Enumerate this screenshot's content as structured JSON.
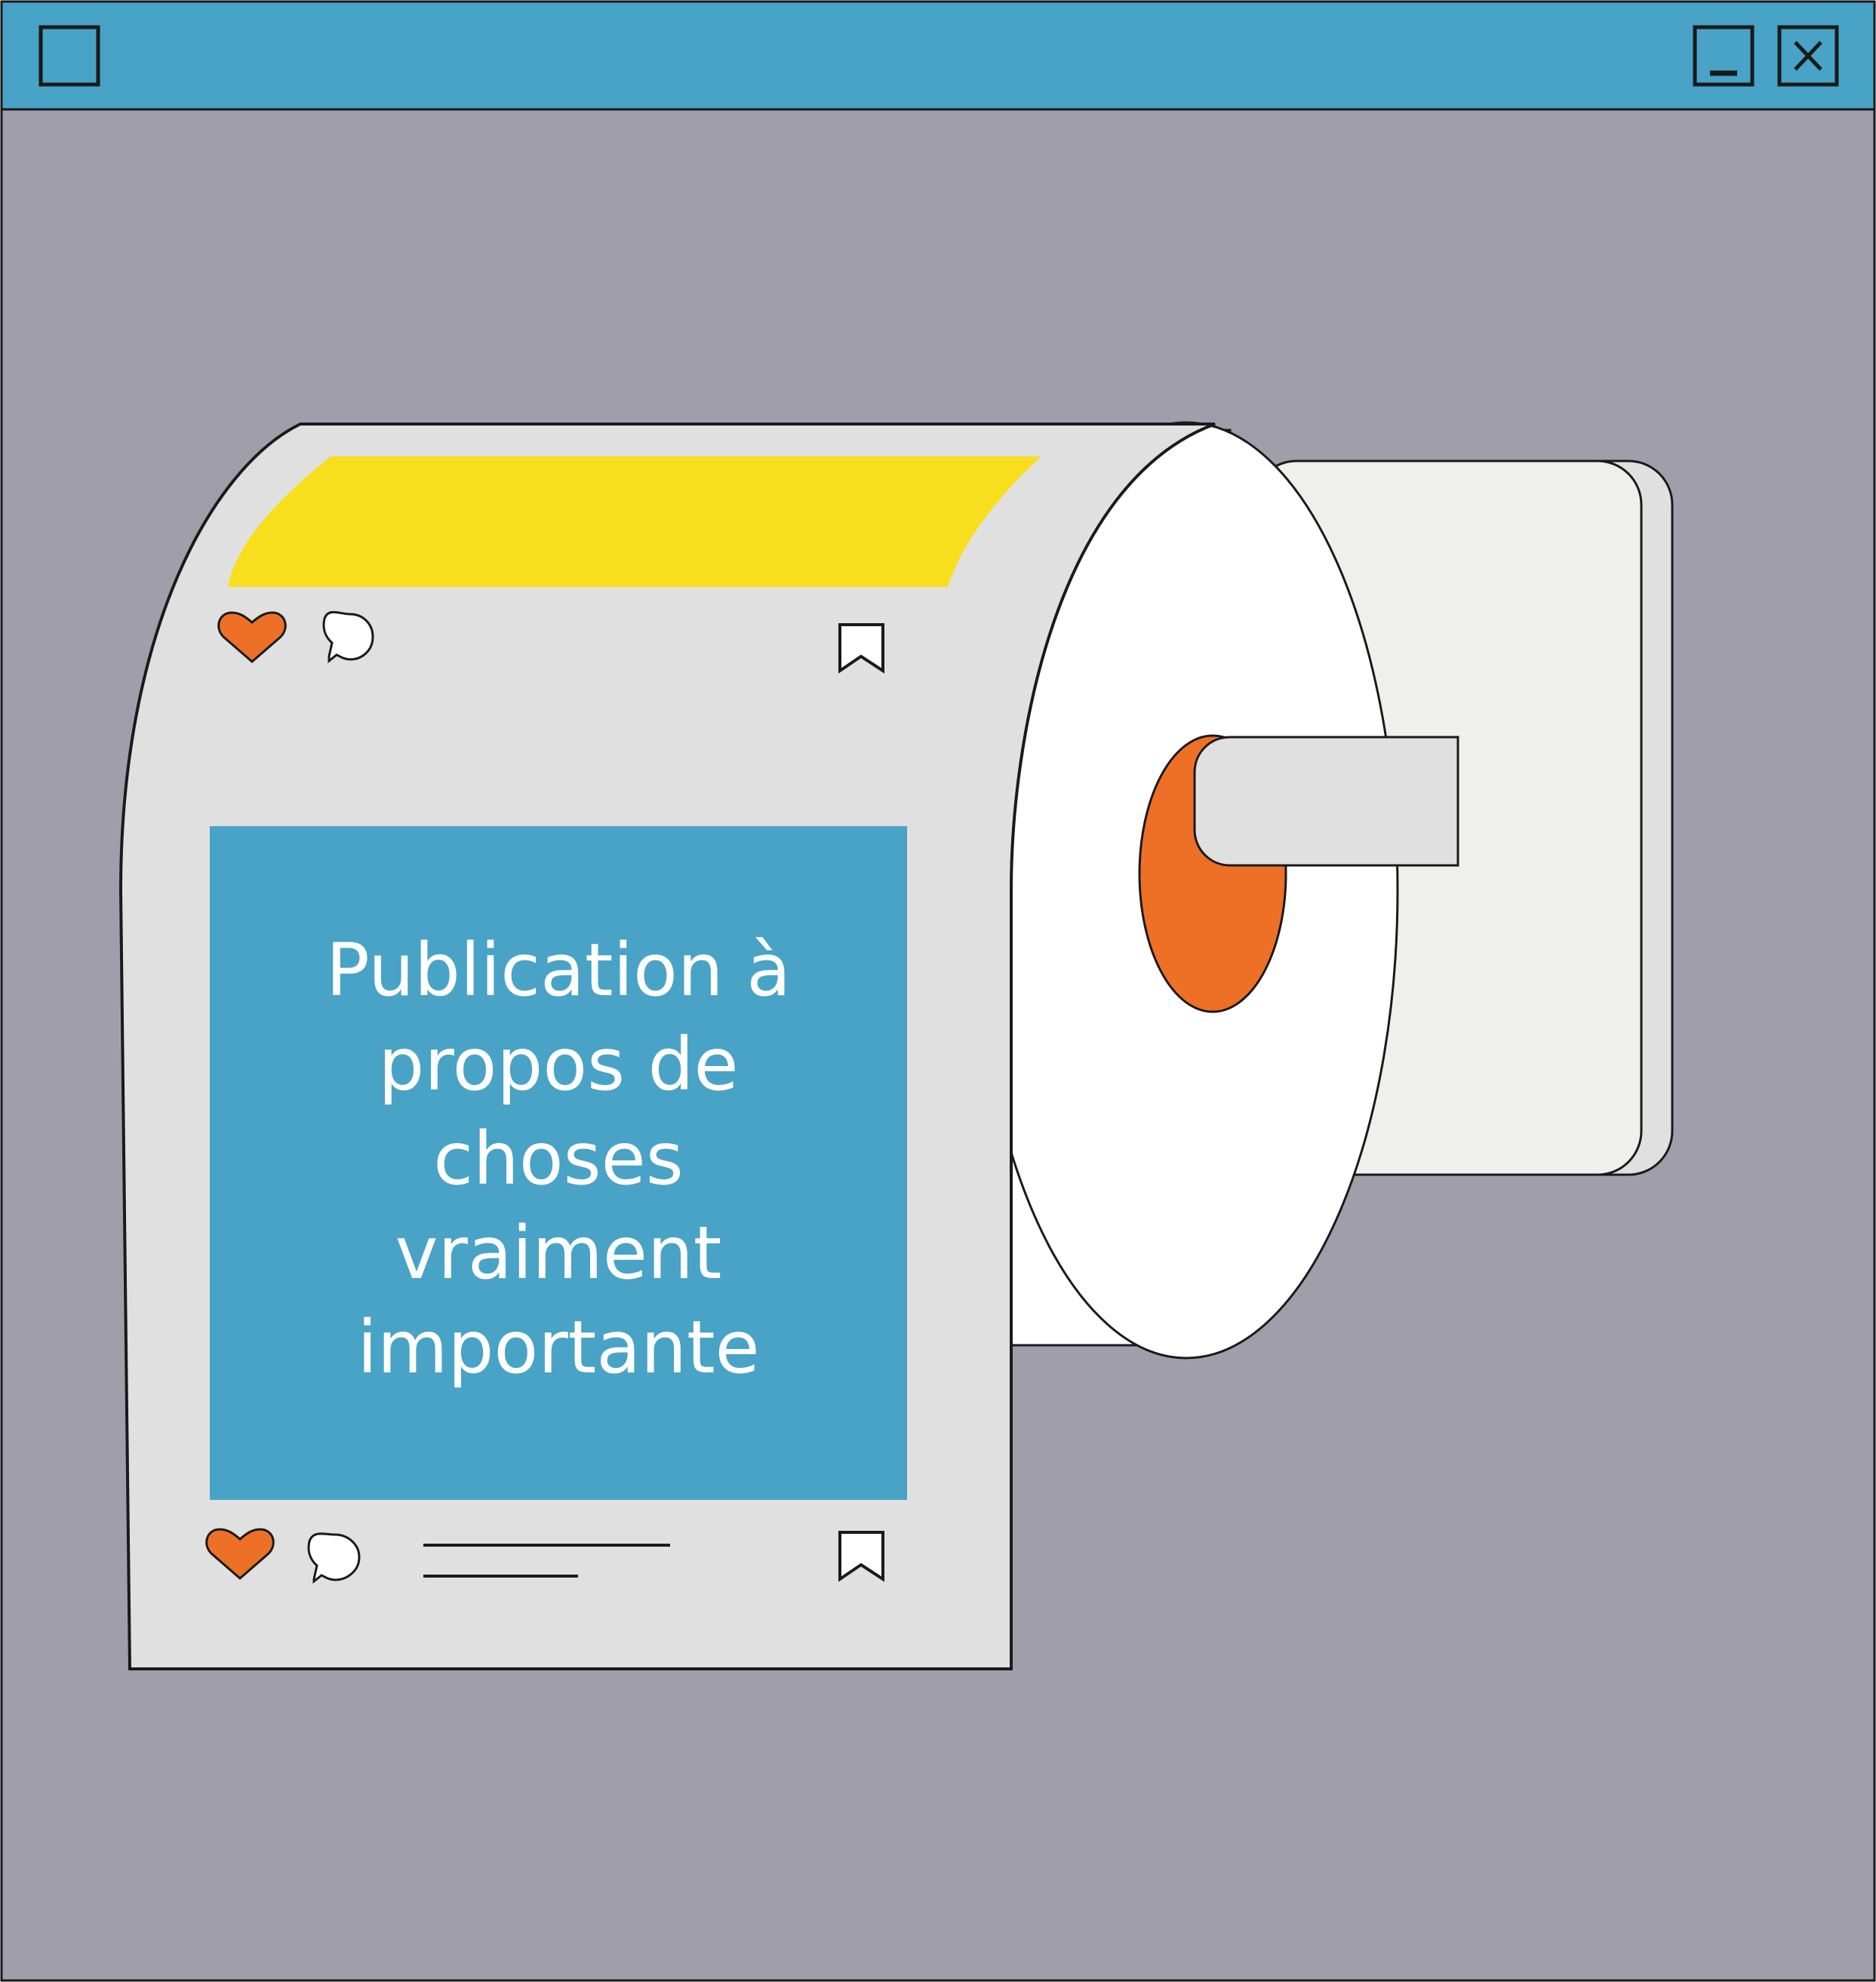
{
  "window": {
    "title_bar_color": "#48A3C6",
    "controls": [
      "window-icon",
      "minimize-icon",
      "close-icon"
    ]
  },
  "colors": {
    "background": "#A09EAA",
    "paper": "#E0E0E1",
    "roll_side": "#FFFFFF",
    "holder": "#EFEFEE",
    "accent_yellow": "#F7DF1E",
    "accent_orange": "#EE7026",
    "post_panel": "#48A3C6",
    "outline": "#1A1A1A"
  },
  "post": {
    "text_lines": [
      "Publication à",
      "propos de",
      "choses",
      "vraiment",
      "importante"
    ]
  },
  "icons": {
    "top_row": [
      "heart-icon",
      "comment-icon",
      "bookmark-icon"
    ],
    "bottom_row": [
      "heart-icon",
      "comment-icon",
      "bookmark-icon"
    ]
  }
}
